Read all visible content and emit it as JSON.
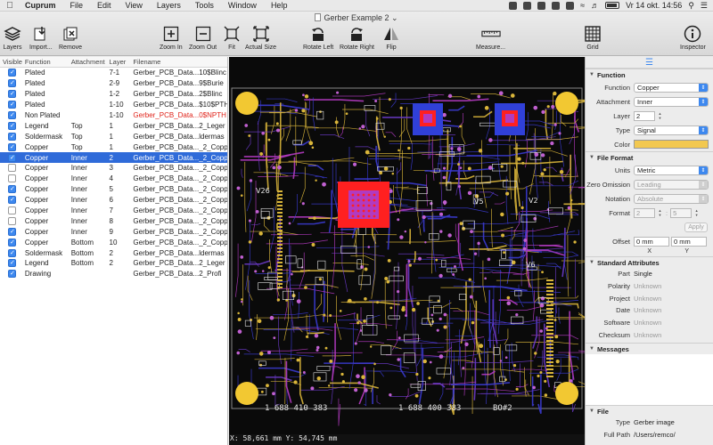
{
  "menubar": {
    "app": "Cuprum",
    "items": [
      "File",
      "Edit",
      "View",
      "Layers",
      "Tools",
      "Window",
      "Help"
    ],
    "clock": "Vr 14 okt.  14:56"
  },
  "window": {
    "title": "Gerber Example 2"
  },
  "toolbar": {
    "layers": "Layers",
    "import": "Import...",
    "remove": "Remove",
    "zoom_in": "Zoom In",
    "zoom_out": "Zoom Out",
    "fit": "Fit",
    "actual_size": "Actual Size",
    "rotate_left": "Rotate Left",
    "rotate_right": "Rotate Right",
    "flip": "Flip",
    "measure": "Measure...",
    "grid": "Grid",
    "inspector": "Inspector"
  },
  "layer_table": {
    "headers": {
      "visible": "Visible",
      "function": "Function",
      "attachment": "Attachment",
      "layer": "Layer",
      "filename": "Filename"
    },
    "rows": [
      {
        "visible": true,
        "function": "Plated",
        "attachment": "",
        "layer": "7-1",
        "filename": "Gerber_PCB_Data...10$Blinc"
      },
      {
        "visible": true,
        "function": "Plated",
        "attachment": "",
        "layer": "2-9",
        "filename": "Gerber_PCB_Data...9$Burie"
      },
      {
        "visible": true,
        "function": "Plated",
        "attachment": "",
        "layer": "1-2",
        "filename": "Gerber_PCB_Data...2$Blinc"
      },
      {
        "visible": true,
        "function": "Plated",
        "attachment": "",
        "layer": "1-10",
        "filename": "Gerber_PCB_Data...$10$PTH"
      },
      {
        "visible": true,
        "function": "Non Plated",
        "attachment": "",
        "layer": "1-10",
        "filename": "Gerber_PCB_Data...0$NPTH"
      },
      {
        "visible": true,
        "function": "Legend",
        "attachment": "Top",
        "layer": "1",
        "filename": "Gerber_PCB_Data...2_Leger"
      },
      {
        "visible": true,
        "function": "Soldermask",
        "attachment": "Top",
        "layer": "1",
        "filename": "Gerber_PCB_Data...ldermas"
      },
      {
        "visible": true,
        "function": "Copper",
        "attachment": "Top",
        "layer": "1",
        "filename": "Gerber_PCB_Data..._2_Copp"
      },
      {
        "visible": true,
        "function": "Copper",
        "attachment": "Inner",
        "layer": "2",
        "filename": "Gerber_PCB_Data..._2_Copp"
      },
      {
        "visible": false,
        "function": "Copper",
        "attachment": "Inner",
        "layer": "3",
        "filename": "Gerber_PCB_Data..._2_Copp"
      },
      {
        "visible": false,
        "function": "Copper",
        "attachment": "Inner",
        "layer": "4",
        "filename": "Gerber_PCB_Data..._2_Copp"
      },
      {
        "visible": true,
        "function": "Copper",
        "attachment": "Inner",
        "layer": "5",
        "filename": "Gerber_PCB_Data..._2_Copp"
      },
      {
        "visible": true,
        "function": "Copper",
        "attachment": "Inner",
        "layer": "6",
        "filename": "Gerber_PCB_Data..._2_Copp"
      },
      {
        "visible": false,
        "function": "Copper",
        "attachment": "Inner",
        "layer": "7",
        "filename": "Gerber_PCB_Data..._2_Copp"
      },
      {
        "visible": false,
        "function": "Copper",
        "attachment": "Inner",
        "layer": "8",
        "filename": "Gerber_PCB_Data..._2_Copp"
      },
      {
        "visible": true,
        "function": "Copper",
        "attachment": "Inner",
        "layer": "9",
        "filename": "Gerber_PCB_Data..._2_Copp"
      },
      {
        "visible": true,
        "function": "Copper",
        "attachment": "Bottom",
        "layer": "10",
        "filename": "Gerber_PCB_Data..._2_Coppe"
      },
      {
        "visible": true,
        "function": "Soldermask",
        "attachment": "Bottom",
        "layer": "2",
        "filename": "Gerber_PCB_Data...ldermas"
      },
      {
        "visible": true,
        "function": "Legend",
        "attachment": "Bottom",
        "layer": "2",
        "filename": "Gerber_PCB_Data...2_Leger"
      },
      {
        "visible": true,
        "function": "Drawing",
        "attachment": "",
        "layer": "",
        "filename": "Gerber_PCB_Data...2_Profi"
      }
    ]
  },
  "canvas": {
    "texts": {
      "board_id_left": "1  688  410  383",
      "board_id_right": "1  688  400  383",
      "bo_mark": "BO#2",
      "v26": "V26",
      "v5": "V5",
      "v6": "V6",
      "v2": "V2"
    },
    "colors": {
      "background": "#0a0a0a",
      "legend": "#e6e6e6",
      "copper_gold": "#d9b53a",
      "inner_blue": "#3a3acf",
      "inner_purple": "#b23ac0",
      "pad_red": "#ff2020",
      "corner_pad": "#f2c832"
    }
  },
  "status": {
    "coords": "X: 58,661 mm  Y: 54,745 mm"
  },
  "inspector": {
    "function_section": {
      "title": "Function",
      "function_label": "Function",
      "function_value": "Copper",
      "attachment_label": "Attachment",
      "attachment_value": "Inner",
      "layer_label": "Layer",
      "layer_value": "2",
      "type_label": "Type",
      "type_value": "Signal",
      "color_label": "Color"
    },
    "file_format": {
      "title": "File Format",
      "units_label": "Units",
      "units_value": "Metric",
      "zero_label": "Zero Omission",
      "zero_value": "Leading",
      "notation_label": "Notation",
      "notation_value": "Absolute",
      "format_label": "Format",
      "format_a": "2",
      "format_sep": ":",
      "format_b": "5",
      "apply": "Apply",
      "offset_label": "Offset",
      "offset_x": "0 mm",
      "offset_y": "0 mm",
      "x_label": "X",
      "y_label": "Y"
    },
    "standard_attributes": {
      "title": "Standard Attributes",
      "rows": [
        {
          "label": "Part",
          "value": "Single",
          "unknown": false
        },
        {
          "label": "Polarity",
          "value": "Unknown",
          "unknown": true
        },
        {
          "label": "Project",
          "value": "Unknown",
          "unknown": true
        },
        {
          "label": "Date",
          "value": "Unknown",
          "unknown": true
        },
        {
          "label": "Software",
          "value": "Unknown",
          "unknown": true
        },
        {
          "label": "Checksum",
          "value": "Unknown",
          "unknown": true
        }
      ]
    },
    "messages": {
      "title": "Messages"
    },
    "file": {
      "title": "File",
      "type_label": "Type",
      "type_value": "Gerber image",
      "path_label": "Full Path",
      "path_value": "/Users/remco/"
    }
  }
}
